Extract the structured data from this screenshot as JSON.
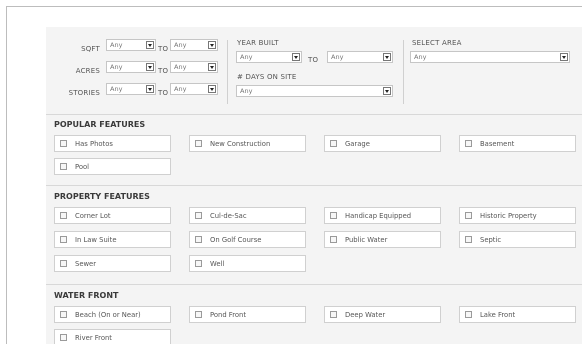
{
  "filters": {
    "sqft_label": "SQFT",
    "acres_label": "ACRES",
    "stories_label": "STORIES",
    "to_label": "TO",
    "any": "Any",
    "year_built_label": "YEAR BUILT",
    "days_on_site_label": "# DAYS ON SITE",
    "select_area_label": "SELECT AREA"
  },
  "sections": {
    "popular": {
      "title": "POPULAR FEATURES",
      "items": [
        "Has Photos",
        "New Construction",
        "Garage",
        "Basement",
        "Pool"
      ]
    },
    "property": {
      "title": "PROPERTY FEATURES",
      "items": [
        "Corner Lot",
        "Cul-de-Sac",
        "Handicap Equipped",
        "Historic Property",
        "In Law Suite",
        "On Golf Course",
        "Public Water",
        "Septic",
        "Sewer",
        "Well"
      ]
    },
    "water": {
      "title": "WATER FRONT",
      "items": [
        "Beach (On or Near)",
        "Pond Front",
        "Deep Water",
        "Lake Front",
        "River Front"
      ]
    }
  },
  "icons": {
    "dropdown": "chevron-down-icon",
    "checkbox": "checkbox-icon"
  }
}
